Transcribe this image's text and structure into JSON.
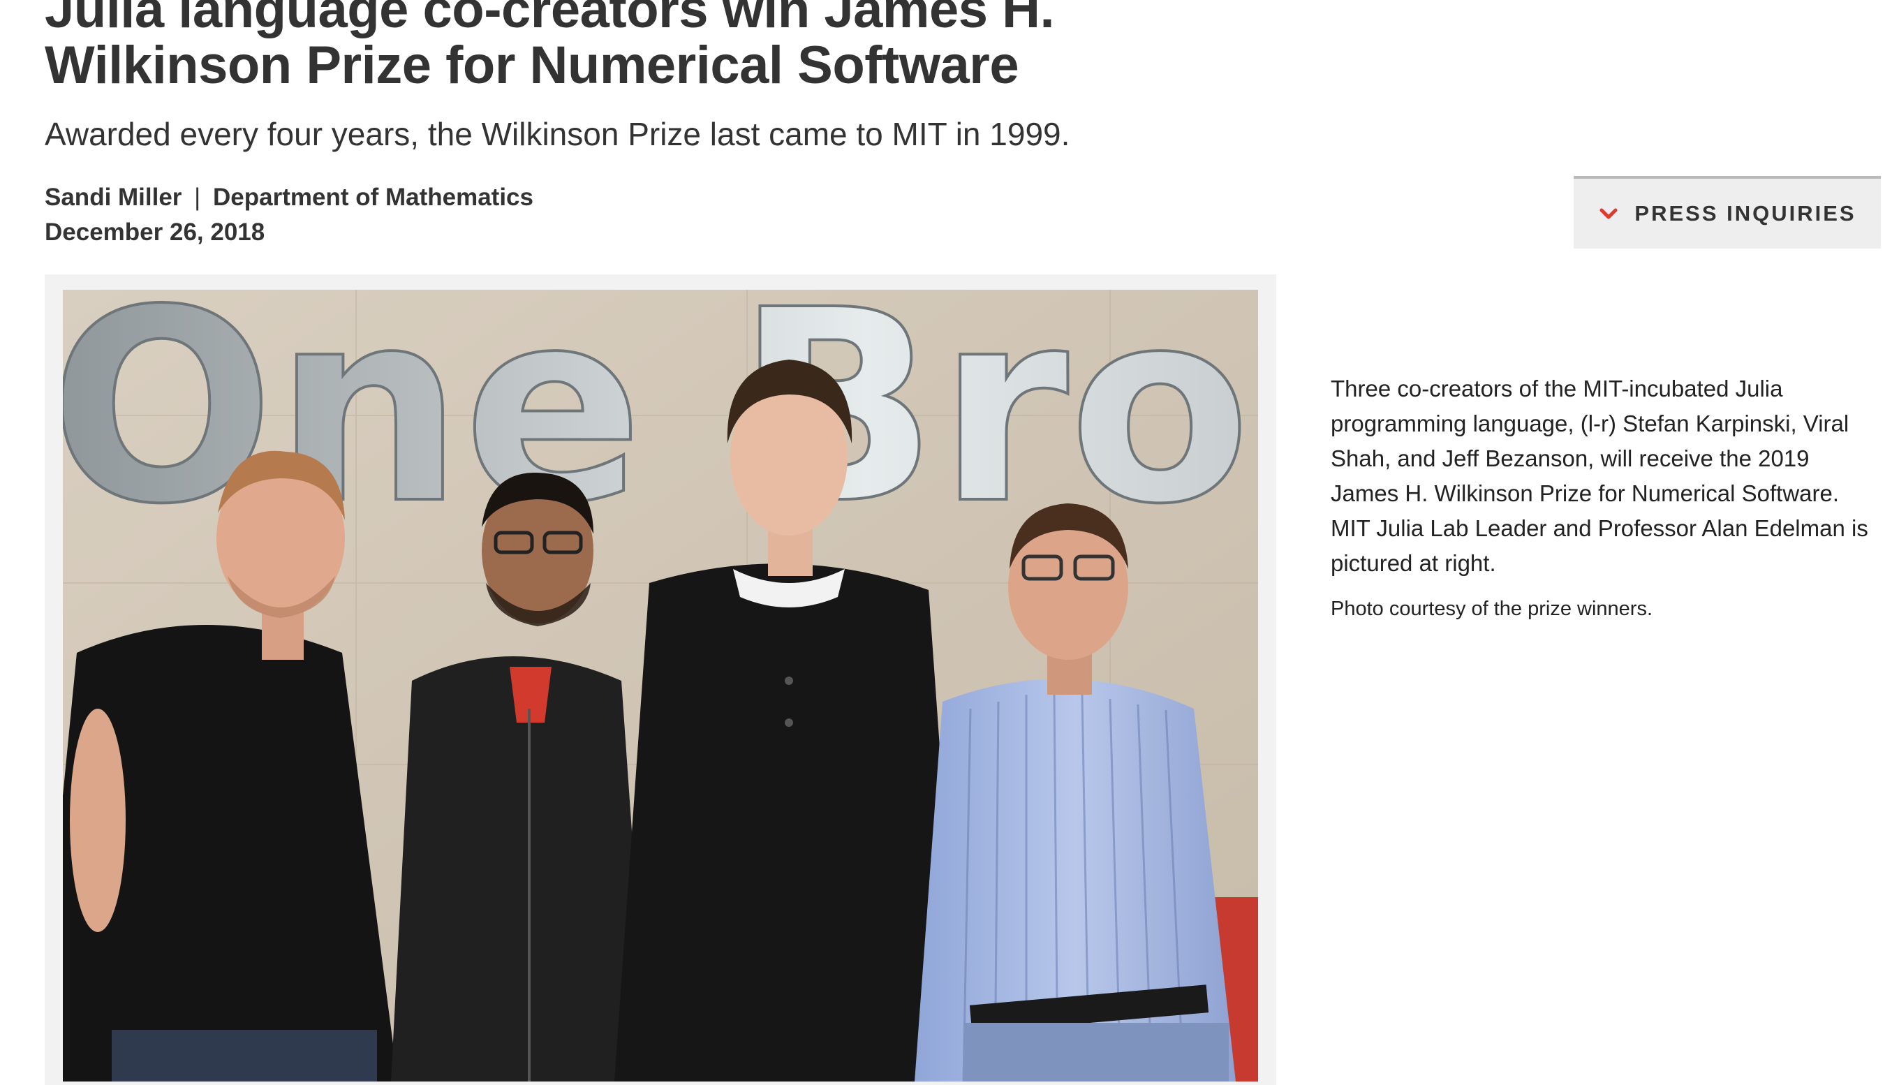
{
  "article": {
    "headline": "Julia language co-creators win James H. Wilkinson Prize for Numerical Software",
    "subhead": "Awarded every four years, the Wilkinson Prize last came to MIT in 1999.",
    "author": "Sandi Miller",
    "separator": "|",
    "department": "Department of Mathematics",
    "date": "December 26, 2018"
  },
  "press_inquiries": {
    "label": "PRESS INQUIRIES",
    "icon": "chevron-down-icon",
    "icon_color": "#e03a2f"
  },
  "photo": {
    "sign_text": "One Broadw",
    "caption": "Three co-creators of the MIT-incubated Julia programming language, (l-r) Stefan Karpinski, Viral Shah, and Jeff Bezanson, will receive the 2019 James H. Wilkinson Prize for Numerical Software. MIT Julia Lab Leader and Professor Alan Edelman is pictured at right.",
    "credit": "Photo courtesy of the prize winners."
  }
}
